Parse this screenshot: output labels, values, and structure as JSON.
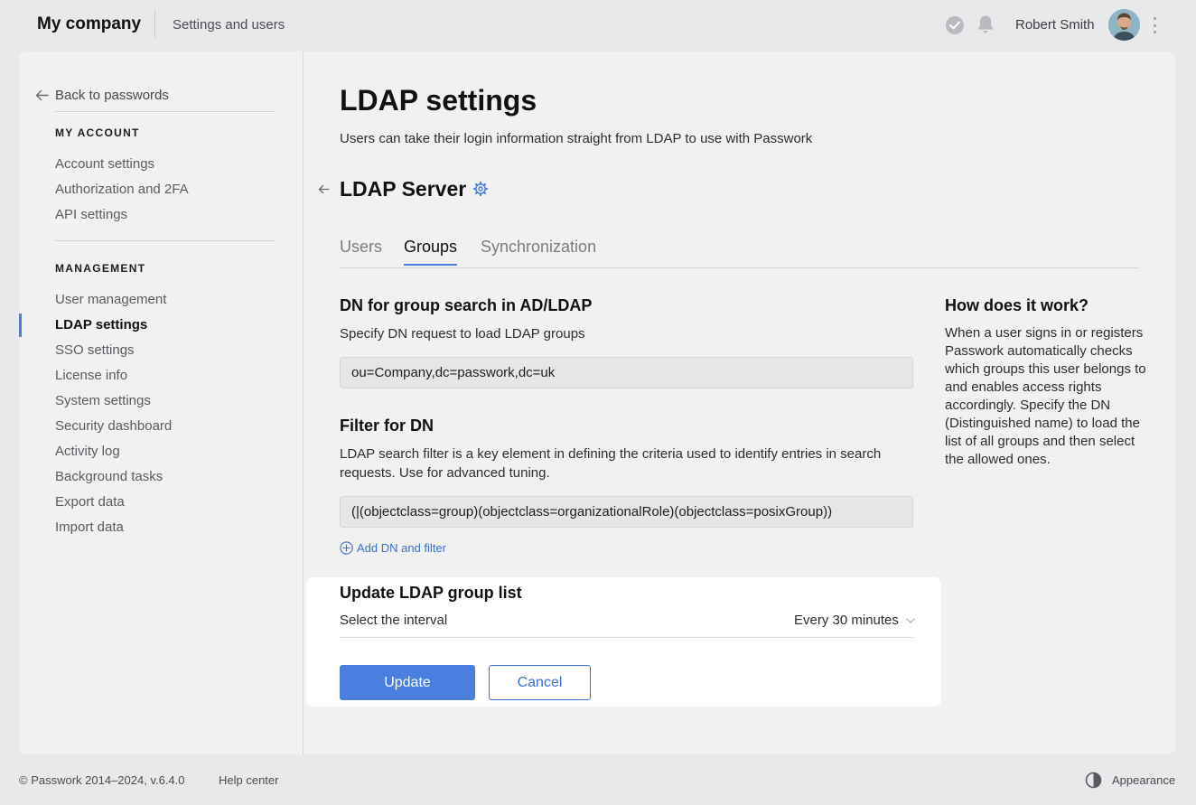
{
  "header": {
    "company": "My company",
    "section": "Settings and users",
    "user_name": "Robert Smith"
  },
  "sidebar": {
    "back_label": "Back to passwords",
    "my_account_heading": "MY ACCOUNT",
    "my_account_items": [
      "Account settings",
      "Authorization and 2FA",
      "API settings"
    ],
    "management_heading": "MANAGEMENT",
    "management_items": [
      "User management",
      "LDAP settings",
      "SSO settings",
      "License info",
      "System settings",
      "Security dashboard",
      "Activity log",
      "Background tasks",
      "Export data",
      "Import data"
    ],
    "active_item": "LDAP settings"
  },
  "page": {
    "title": "LDAP settings",
    "subtitle": "Users can take their login information straight from LDAP to use with Passwork",
    "server_title": "LDAP Server",
    "tabs": [
      "Users",
      "Groups",
      "Synchronization"
    ],
    "active_tab": "Groups"
  },
  "groups": {
    "dn_title": "DN for group search in AD/LDAP",
    "dn_desc": "Specify DN request to load LDAP groups",
    "dn_value": "ou=Company,dc=passwork,dc=uk",
    "filter_title": "Filter for DN",
    "filter_desc": "LDAP search filter is a key element in defining the criteria used to identify entries in search requests. Use for advanced tuning.",
    "filter_value": "(|(objectclass=group)(objectclass=organizationalRole)(objectclass=posixGroup))",
    "add_label": "Add DN and filter"
  },
  "help": {
    "title": "How does it work?",
    "text": "When a user signs in or registers Passwork automatically checks which groups this user belongs to and enables access rights accordingly. Specify the DN (Distinguished name) to load the list of all groups and then select the allowed ones."
  },
  "update": {
    "title": "Update LDAP group list",
    "interval_label": "Select the interval",
    "interval_value": "Every 30 minutes",
    "update_button": "Update",
    "cancel_button": "Cancel"
  },
  "footer": {
    "copyright": "© Passwork 2014–2024, v.6.4.0",
    "help": "Help center",
    "appearance": "Appearance"
  },
  "colors": {
    "accent": "#4a7fe0",
    "link": "#3b6fd1",
    "background": "#e8e9eb",
    "card": "#f1f1f2"
  }
}
